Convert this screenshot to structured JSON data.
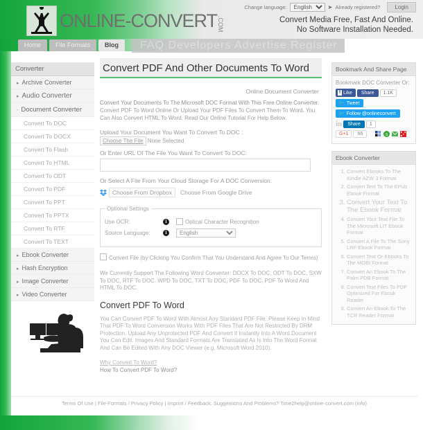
{
  "header": {
    "change_language_label": "Change language:",
    "language_value": "English",
    "language_options": [
      "English"
    ],
    "go_arrow": "➤",
    "already_registered": "Already registered?",
    "login_label": "Login",
    "logo_text": "ONLINE-CONVERT",
    "logo_dotcom": ".COM",
    "tagline_line1": "Convert Media Free, Fast And Online.",
    "tagline_line2": "No Software Installation Needed.",
    "brand_green": "#18a63d"
  },
  "nav": {
    "tabs": [
      {
        "label": "Home",
        "active": false
      },
      {
        "label": "File Formats",
        "active": false
      },
      {
        "label": "Blog",
        "active": true
      }
    ],
    "wide_tab": "FAQ Developers Advertise Register"
  },
  "sidebar_left": {
    "heading": "Converter",
    "items": [
      {
        "label": "Archive Converter",
        "caret": "▸",
        "level": 1
      },
      {
        "label": "Audio Converter",
        "caret": "▸",
        "level": 1
      },
      {
        "label": "Document Converter",
        "caret": "-",
        "level": 1,
        "open": true
      }
    ],
    "document_sub_items": [
      "Convert To DOC",
      "Convert To DOCX",
      "Convert To Flash",
      "Convert To HTML",
      "Convert To ODT",
      "Convert To PDF",
      "Convert To PPT",
      "Convert To PPTX",
      "Convert To RTF",
      "Convert To TEXT"
    ],
    "items_after": [
      {
        "label": "Ebook Converter",
        "caret": "▸",
        "level": 1
      },
      {
        "label": "Hash Encryption",
        "caret": "▸",
        "level": 1
      },
      {
        "label": "Image Converter",
        "caret": "▸",
        "level": 1
      },
      {
        "label": "Video Converter",
        "caret": "▸",
        "level": 1
      }
    ]
  },
  "main": {
    "page_title": "Convert PDF And Other Documents To Word",
    "subtitle": "Online Document Converter",
    "description_line1": "Convert Your Documents To The Microsoft DOC Format With This Free Online Converter.",
    "description_line2": "Convert PDF To Word Online Or Upload Your PDF Files To Convert Them To Word. You Can Also Convert HTML To Word. Read Our Online Tutorial For Help Below.",
    "upload_label": "Upload Your Document You Want To Convert To DOC :",
    "choose_file_button": "Choose The File",
    "no_file_selected": "None Selected",
    "url_label": "Or Enter URL Of The File You Want To Convert To DOC:",
    "url_value": "",
    "url_placeholder": "",
    "cloud_label": "Or Select A File From Your Cloud Storage For A DOC Conversion:",
    "dropbox_button": "Choose From Dropbox",
    "gdrive_button": "Choose From Google Drive",
    "optional_legend": "Optional Settings",
    "ocr_label": "Use OCR:",
    "ocr_checkbox_text": "Optical Character Recognition",
    "ocr_checked": false,
    "source_language_label": "Source Language:",
    "source_language_value": "English",
    "source_language_options": [
      "English"
    ],
    "convert_checkbox_text": "Convert File (by Clicking You Confirm That You Understand And Agree To Our Terms)",
    "convert_checked": false,
    "support_text": "We Currently Support The Following Word Converter: DOCX To DOC, ODT To DOC, SXW To DOC, RTF To DOC, WPD To DOC, TXT To DOC, PDF To DOC, PDF To Word And HTML To DOC.",
    "section_title": "Convert PDF To Word",
    "section_body": "You Can Convert PDF To Word With Almost Any Standard PDF File. Please Keep In Mind That PDF To Word Conversion Works With PDF Files That Are Not Restricted By DRM Protection. Upload Any Unprotected PDF And Convert It Instantly Into A Word Document You Can Edit. Images And Standard Formats Are Translated As Is Into The Word Format And Can Be Edited With Any DOC Viewer (e.g. Microsoft Word 2010).",
    "link_1": "Why Convert To Word?",
    "link_2": "How To Convert PDF To Word?"
  },
  "sidebar_right": {
    "share_heading": "Bookmark And Share Page",
    "bookmark_text": "Bookmark DOC Converter Or:",
    "facebook_like": "Like",
    "facebook_share": "Share",
    "facebook_count": "1.1K",
    "twitter_tweet": "Tweet",
    "twitter_follow": "Follow @onlineconvert",
    "linkedin_share": "Share",
    "linkedin_count": "1",
    "gplus_label": "G+1",
    "gplus_count": "66",
    "ebook_heading": "Ebook Converter",
    "ebook_items": [
      "Convert Ebooks To The Kindle AZW 3 Format",
      "Convert Text To The EPub Ebook Format",
      "Convert Your Text To The Ebook Format",
      "Convert Your Text File To The Microsoft LIT Ebook Format",
      "Convert A File To The Sony LRF Ebook Format",
      "Convert Text Or Ebooks To The MOBI Format",
      "Convert An Ebook To The Palm PDB Format",
      "Convert Text Files To PDF Optimized For Ebook Reader",
      "Convert An Ebook To The TCR Reader Format"
    ]
  },
  "footer": {
    "text": "Terms Of Use | File Formats / Privacy Policy | Imprint / Feedback. Suggestions And Problems? Time2help@online-convert.com (info)"
  }
}
